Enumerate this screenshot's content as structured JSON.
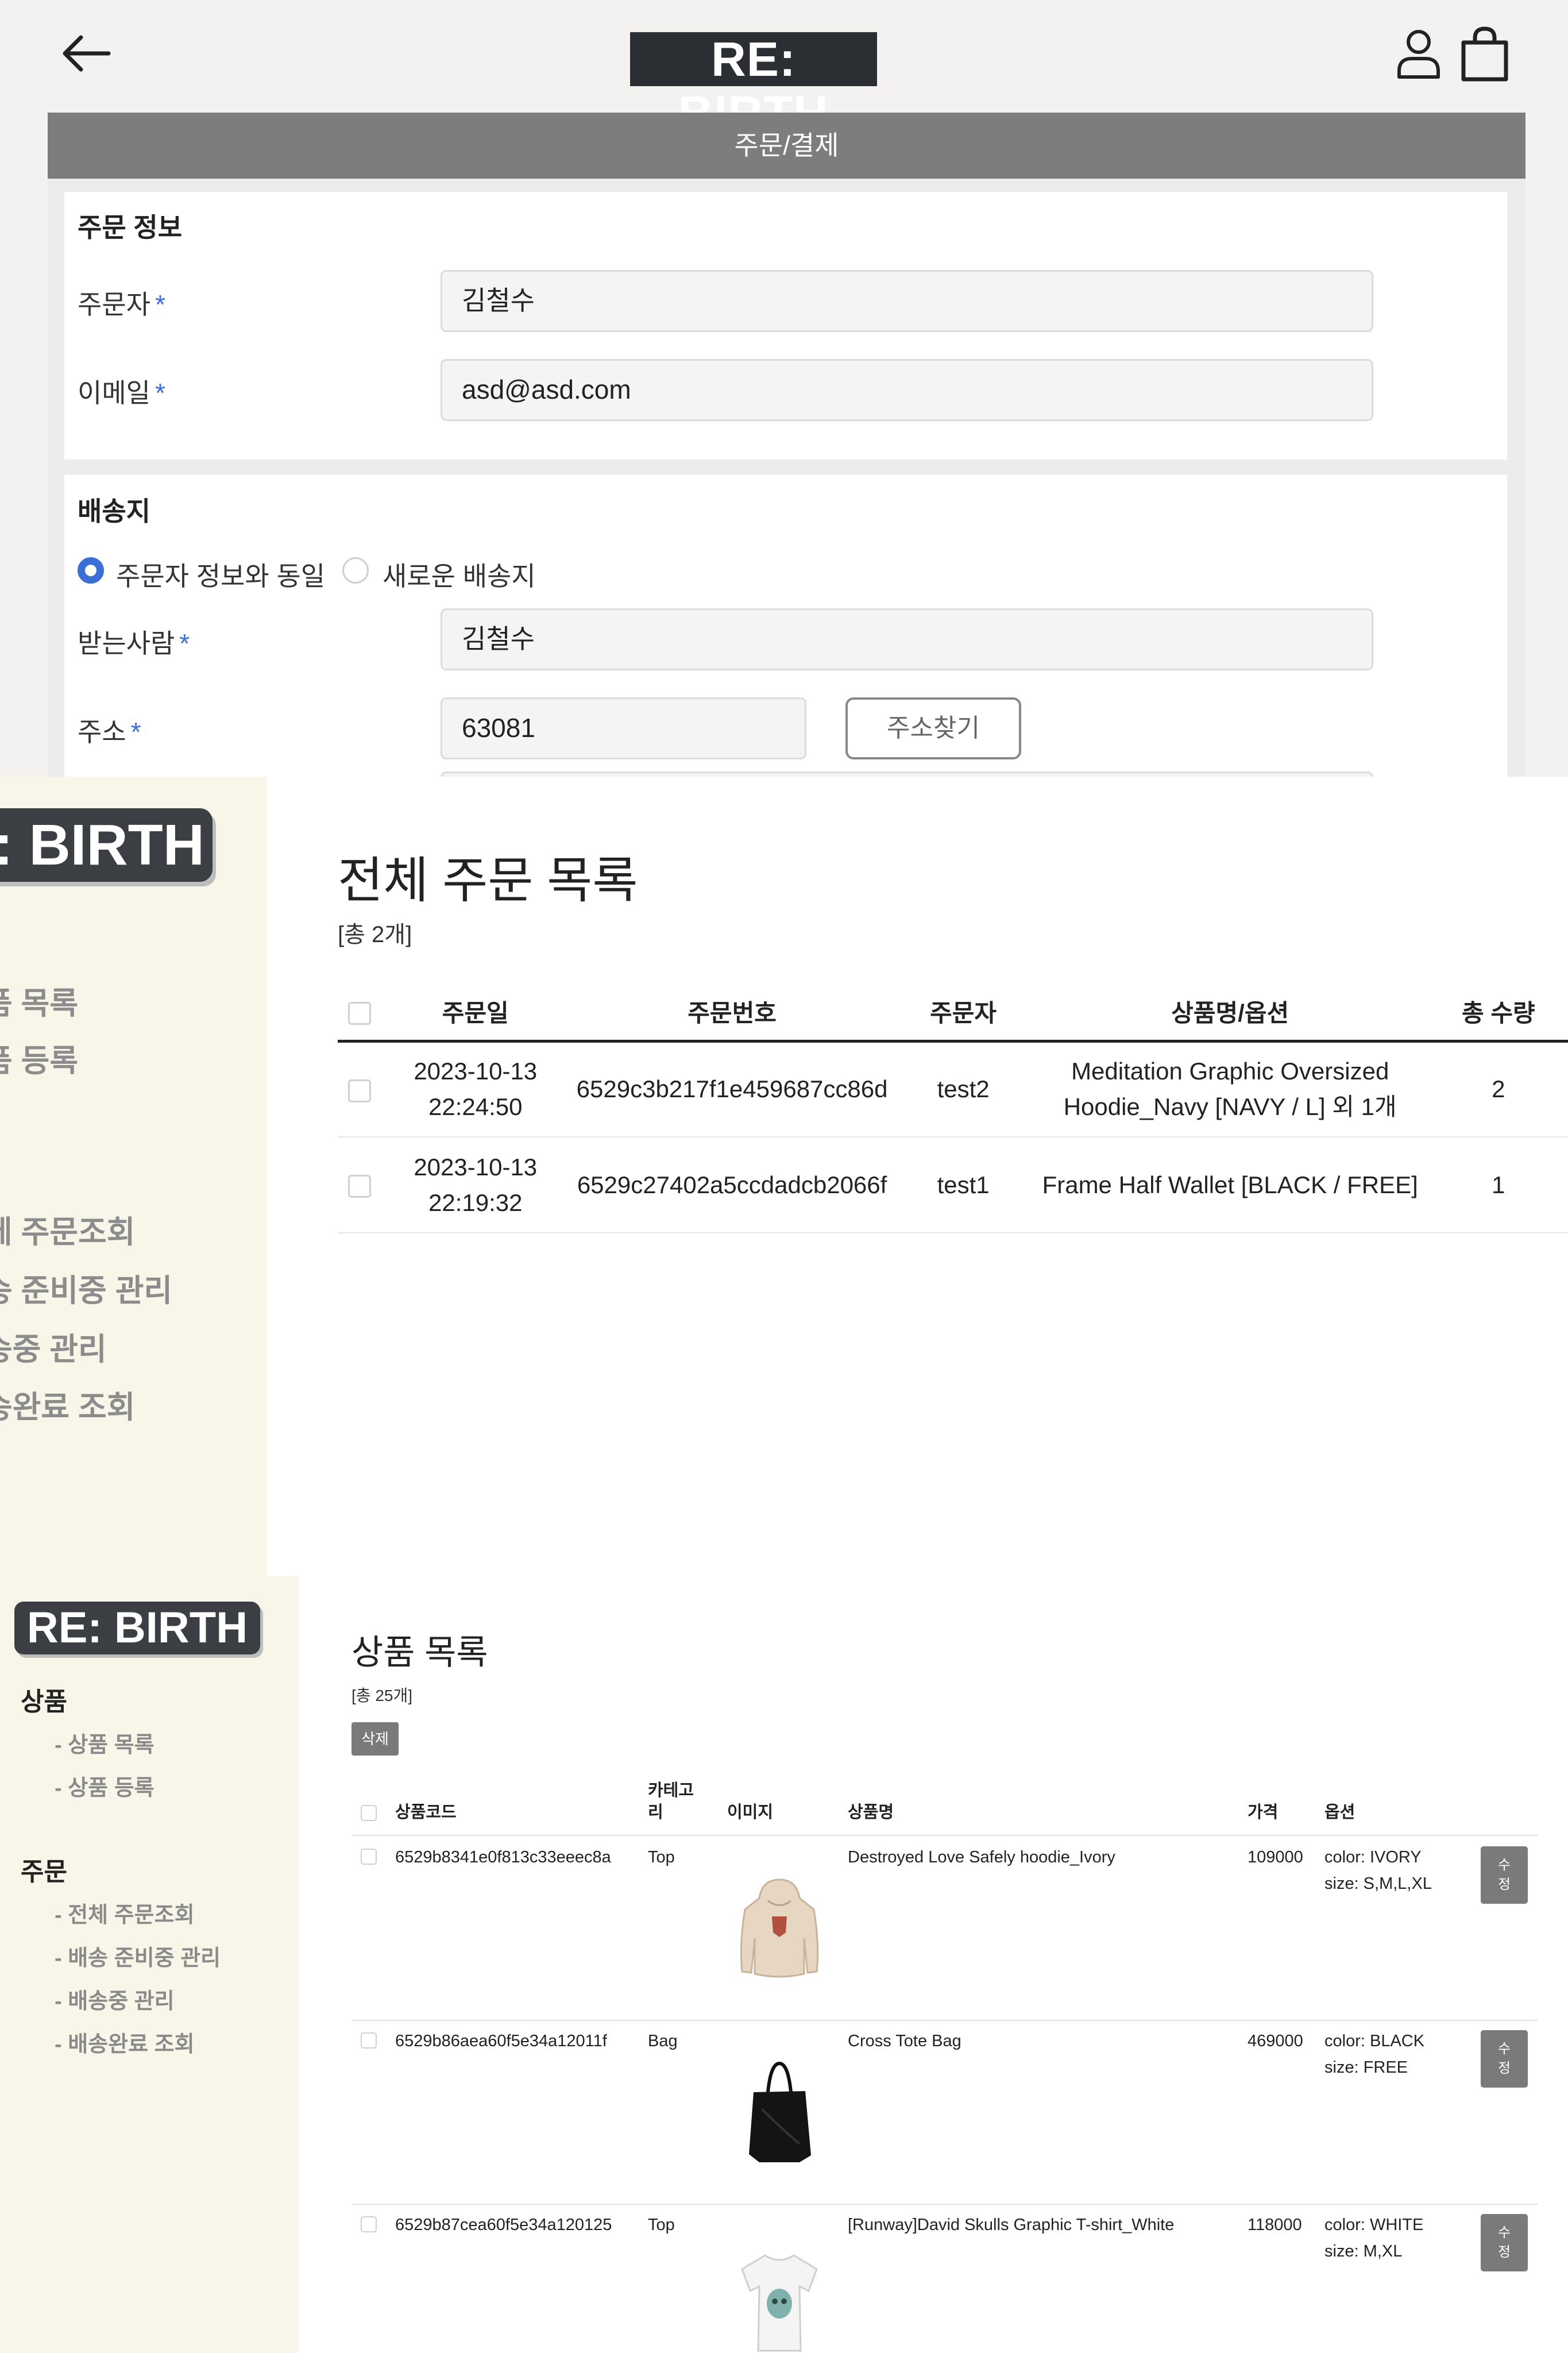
{
  "checkout": {
    "logo": "RE: BIRTH",
    "page_title": "주문/결제",
    "order_info": {
      "heading": "주문 정보",
      "orderer_label": "주문자",
      "orderer_value": "김철수",
      "email_label": "이메일",
      "email_value": "asd@asd.com",
      "required_mark": "*"
    },
    "shipping": {
      "heading": "배송지",
      "option_same": "주문자 정보와 동일",
      "option_new": "새로운 배송지",
      "selected_option": "주문자 정보와 동일",
      "recipient_label": "받는사람",
      "recipient_value": "김철수",
      "address_label": "주소",
      "zipcode_value": "63081",
      "find_address_button": "주소찾기"
    },
    "colors": {
      "accent": "#3b6fd8",
      "titlebar": "#7d7d7d",
      "logo_bg": "#2b2f33"
    }
  },
  "order_admin": {
    "logo": "RE: BIRTH",
    "nav_items": [
      "상품 목록",
      "상품 등록",
      "전체 주문조회",
      "배송 준비중 관리",
      "배송중 관리",
      "배송완료 조회"
    ],
    "nav_visible": [
      "품 목록",
      "품 등록",
      "체 주문조회",
      "송 준비중 관리",
      "송중 관리",
      "송완료 조회"
    ],
    "title": "전체 주문 목록",
    "count": "[총 2개]",
    "columns": [
      "주문일",
      "주문번호",
      "주문자",
      "상품명/옵션",
      "총 수량"
    ],
    "columns_visible": [
      "주문일",
      "주문번호",
      "주문자",
      "상품명/옵션",
      "총 수량"
    ],
    "rows": [
      {
        "date": "2023-10-13",
        "time": "22:24:50",
        "order_no": "6529c3b217f1e459687cc86d",
        "orderer": "test2",
        "product_line1": "Meditation Graphic Oversized",
        "product_line2": "Hoodie_Navy [NAVY / L] 외 1개",
        "qty": "2"
      },
      {
        "date": "2023-10-13",
        "time": "22:19:32",
        "order_no": "6529c27402a5ccdadcb2066f",
        "orderer": "test1",
        "product_line1": "Frame Half Wallet [BLACK / FREE]",
        "product_line2": "",
        "qty": "1"
      }
    ],
    "sidebar_color": "#f8f6e8"
  },
  "product_admin": {
    "logo": "RE: BIRTH",
    "sidebar": {
      "products_heading": "상품",
      "products_items": [
        "- 상품 목록",
        "- 상품 등록"
      ],
      "orders_heading": "주문",
      "orders_items": [
        "- 전체 주문조회",
        "- 배송 준비중 관리",
        "- 배송중 관리",
        "- 배송완료 조회"
      ]
    },
    "title": "상품 목록",
    "count": "[총 25개]",
    "delete_button": "삭제",
    "columns": {
      "code": "상품코드",
      "category_1": "카테고",
      "category_2": "리",
      "image": "이미지",
      "name": "상품명",
      "price": "가격",
      "options": "옵션"
    },
    "edit_button_1": "수",
    "edit_button_2": "정",
    "rows": [
      {
        "code": "6529b8341e0f813c33eeec8a",
        "category": "Top",
        "name": "Destroyed Love Safely hoodie_Ivory",
        "price": "109000",
        "color": "color: IVORY",
        "size": "size: S,M,L,XL",
        "image_icon": "hoodie-icon"
      },
      {
        "code": "6529b86aea60f5e34a12011f",
        "category": "Bag",
        "name": "Cross Tote Bag",
        "price": "469000",
        "color": "color: BLACK",
        "size": "size: FREE",
        "image_icon": "tote-bag-icon"
      },
      {
        "code": "6529b87cea60f5e34a120125",
        "category": "Top",
        "name": "[Runway]David Skulls Graphic T-shirt_White",
        "price": "118000",
        "color": "color: WHITE",
        "size": "size: M,XL",
        "image_icon": "tshirt-icon"
      }
    ]
  }
}
